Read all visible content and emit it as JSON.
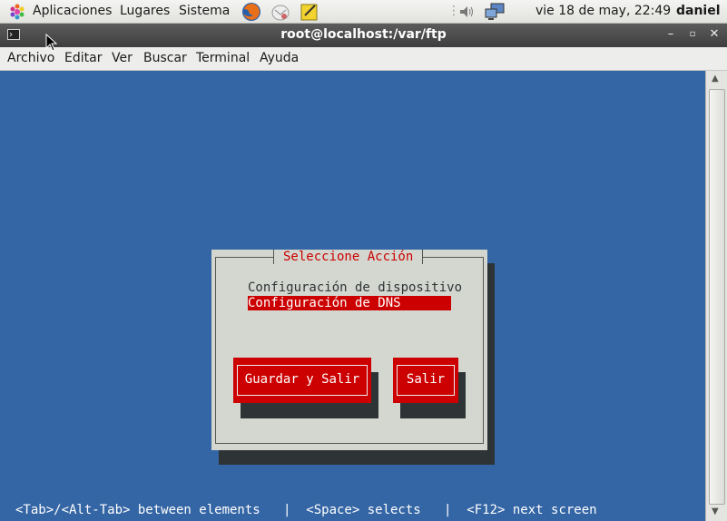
{
  "panel": {
    "applications": "Aplicaciones",
    "places": "Lugares",
    "system": "Sistema",
    "launchers": [
      "firefox-icon",
      "mail-icon",
      "notes-icon"
    ],
    "tray": [
      "volume-icon",
      "network-icon"
    ],
    "clock": "vie 18 de may, 22:49",
    "user": "daniel"
  },
  "window": {
    "title": "root@localhost:/var/ftp",
    "menu": [
      "Archivo",
      "Editar",
      "Ver",
      "Buscar",
      "Terminal",
      "Ayuda"
    ]
  },
  "dialog": {
    "title": "Seleccione Acción",
    "options": [
      "Configuración de dispositivo",
      "Configuración de DNS"
    ],
    "selected_index": 1,
    "buttons": {
      "save_exit": "Guardar y Salir",
      "exit": "Salir"
    }
  },
  "status_line": "<Tab>/<Alt-Tab> between elements   |  <Space> selects   |  <F12> next screen",
  "colors": {
    "desktop_blue": "#3465a4",
    "accent_red": "#cc0000",
    "dialog_gray": "#d3d7cf"
  }
}
